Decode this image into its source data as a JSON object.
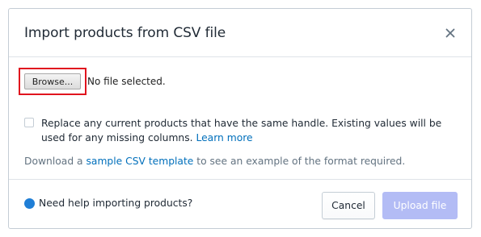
{
  "dialog": {
    "title": "Import products from CSV file",
    "close_icon": "close-icon"
  },
  "file_input": {
    "browse_label": "Browse...",
    "status": "No file selected."
  },
  "overwrite_option": {
    "checked": false,
    "text": "Replace any current products that have the same handle. Existing values will be used for any missing columns.",
    "link_label": "Learn more"
  },
  "template_hint": {
    "prefix": "Download a",
    "link_label": "sample CSV template",
    "suffix": "to see an example of the format required."
  },
  "footer": {
    "help_icon": "info-circle-icon",
    "help_text": "Need help importing products?",
    "cancel_label": "Cancel",
    "upload_label": "Upload file",
    "upload_disabled": true
  },
  "colors": {
    "link": "#006fbb",
    "highlight_border": "#e0141e",
    "upload_disabled_bg": "#b3bcf5",
    "help_icon": "#1f7ed6"
  }
}
